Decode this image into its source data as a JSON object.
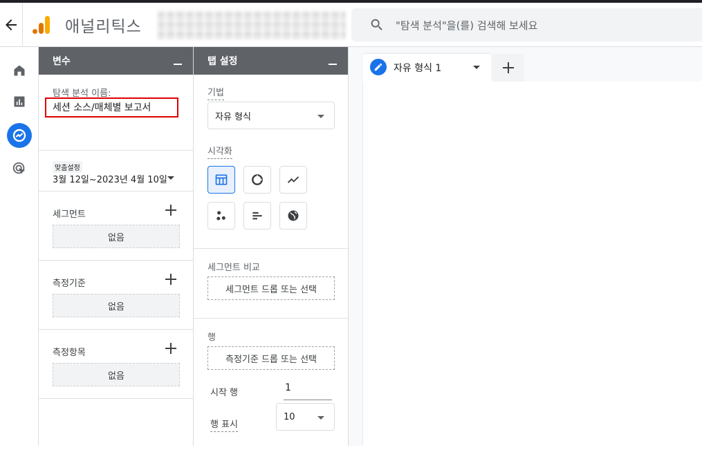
{
  "header": {
    "app_title": "애널리틱스",
    "search_placeholder": "\"탐색 분석\"을(를) 검색해 보세요",
    "brand_colors": {
      "logo_bar1": "#f9ab00",
      "logo_bar2": "#e37400",
      "logo_dot": "#e37400"
    }
  },
  "rail": {
    "items": [
      {
        "icon": "home-icon"
      },
      {
        "icon": "reports-icon"
      },
      {
        "icon": "explore-icon",
        "active": true
      },
      {
        "icon": "advertising-icon"
      }
    ]
  },
  "variables": {
    "title": "변수",
    "explore_name_label": "탐색 분석 이름:",
    "explore_name_value": "세션 소스/매체별 보고서",
    "date_chip": "맞춤설정",
    "date_range": "3월 12일~2023년 4월 10일",
    "segments": {
      "title": "세그먼트",
      "empty": "없음"
    },
    "dimensions": {
      "title": "측정기준",
      "empty": "없음"
    },
    "metrics": {
      "title": "측정항목",
      "empty": "없음"
    }
  },
  "tab_settings": {
    "title": "탭 설정",
    "technique_label": "기법",
    "technique_value": "자유 형식",
    "visualization_label": "시각화",
    "visualizations": [
      "table-icon",
      "donut-chart-icon",
      "line-chart-icon",
      "scatter-plot-icon",
      "bar-chart-icon",
      "geo-map-icon"
    ],
    "segment_compare_label": "세그먼트 비교",
    "segment_compare_drop": "세그먼트 드롭 또는 선택",
    "rows_label": "행",
    "rows_drop": "측정기준 드롭 또는 선택",
    "start_row_label": "시작 행",
    "start_row_value": "1",
    "show_rows_label": "행 표시",
    "show_rows_value": "10"
  },
  "canvas": {
    "tab_label": "자유 형식 1",
    "accent": "#1a73e8"
  }
}
